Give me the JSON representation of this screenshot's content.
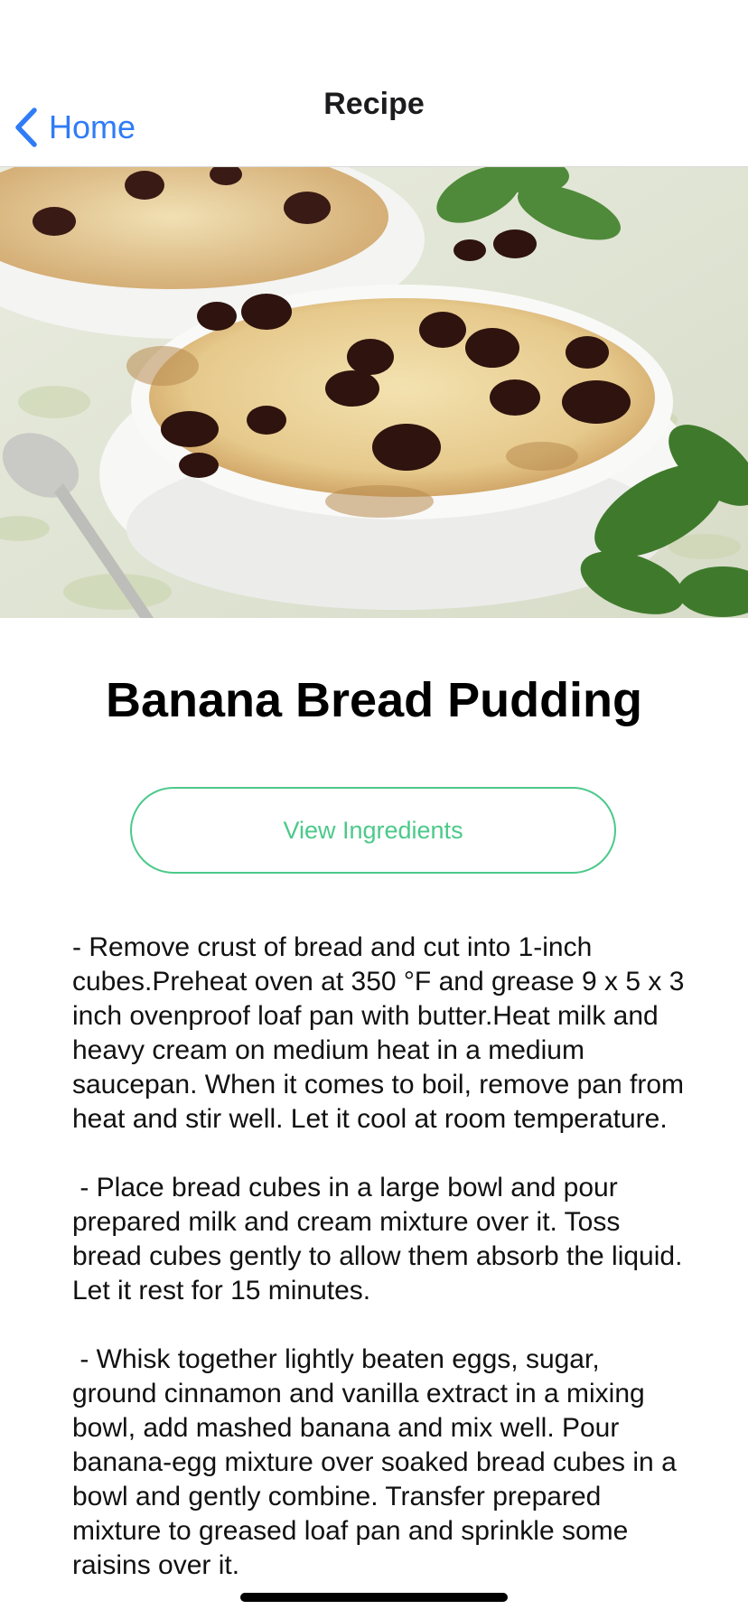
{
  "navbar": {
    "title": "Recipe",
    "back_label": "Home",
    "back_icon": "chevron-left-icon",
    "accent_color": "#2f7cf6"
  },
  "hero": {
    "subject": "bread pudding with raisins in white ramekin"
  },
  "recipe": {
    "title": "Banana Bread Pudding",
    "ingredients_button_label": "View Ingredients",
    "button_color": "#4cc98a",
    "steps": [
      "- Remove crust of bread and cut into 1-inch cubes.Preheat oven at 350 °F and grease 9 x 5 x 3 inch ovenproof loaf pan with butter.Heat milk and heavy cream on medium heat in a medium saucepan. When it comes to boil, remove pan from heat and stir well. Let it cool at room temperature.",
      " - Place bread cubes in a large bowl and pour prepared milk and cream mixture over it. Toss bread cubes gently to allow them absorb the liquid. Let it rest for 15 minutes.",
      " - Whisk together lightly beaten eggs, sugar, ground cinnamon and vanilla extract in a mixing bowl, add mashed banana and mix well. Pour banana-egg mixture over soaked bread cubes in a bowl and gently combine. Transfer prepared mixture to greased loaf pan and sprinkle some raisins over it."
    ]
  }
}
